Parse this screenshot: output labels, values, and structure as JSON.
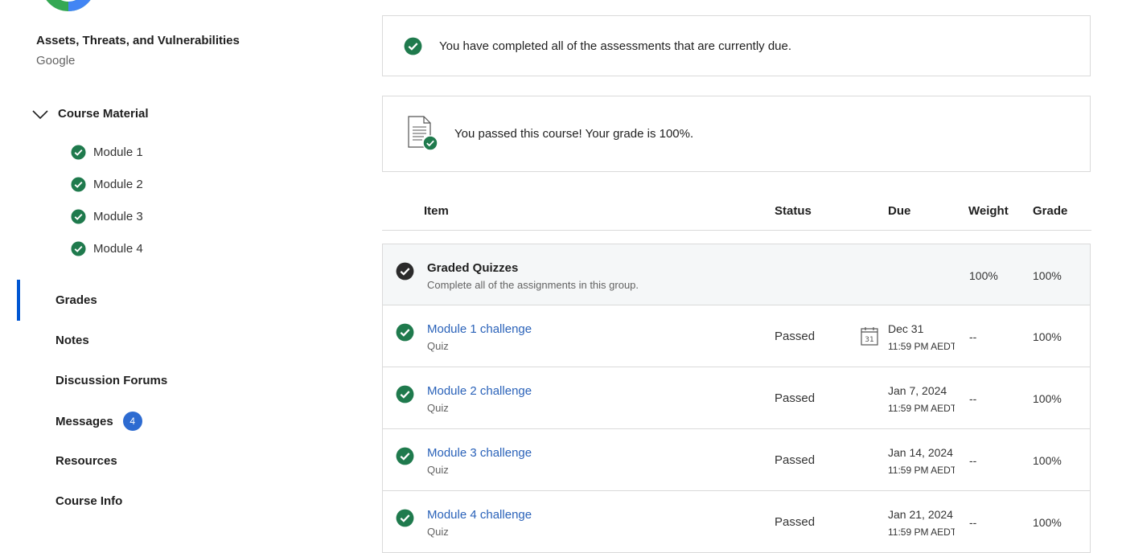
{
  "sidebar": {
    "course_title": "Assets, Threats, and Vulnerabilities",
    "course_org": "Google",
    "course_material_label": "Course Material",
    "modules": [
      {
        "label": "Module 1"
      },
      {
        "label": "Module 2"
      },
      {
        "label": "Module 3"
      },
      {
        "label": "Module 4"
      }
    ],
    "nav": {
      "grades": "Grades",
      "notes": "Notes",
      "discussion_forums": "Discussion Forums",
      "messages": "Messages",
      "messages_badge": "4",
      "resources": "Resources",
      "course_info": "Course Info"
    }
  },
  "main": {
    "assessments_notice": "You have completed all of the assessments that are currently due.",
    "passed_notice": "You passed this course! Your grade is 100%.",
    "table": {
      "headers": {
        "item": "Item",
        "status": "Status",
        "due": "Due",
        "weight": "Weight",
        "grade": "Grade"
      },
      "group": {
        "name": "Graded Quizzes",
        "description": "Complete all of the assignments in this group.",
        "weight": "100%",
        "grade": "100%"
      },
      "rows": [
        {
          "name": "Module 1 challenge",
          "type": "Quiz",
          "status": "Passed",
          "due_date": "Dec 31",
          "due_time": "11:59 PM AEDT",
          "weight": "--",
          "grade": "100%"
        },
        {
          "name": "Module 2 challenge",
          "type": "Quiz",
          "status": "Passed",
          "due_date": "Jan 7, 2024",
          "due_time": "11:59 PM AEDT",
          "weight": "--",
          "grade": "100%"
        },
        {
          "name": "Module 3 challenge",
          "type": "Quiz",
          "status": "Passed",
          "due_date": "Jan 14, 2024",
          "due_time": "11:59 PM AEDT",
          "weight": "--",
          "grade": "100%"
        },
        {
          "name": "Module 4 challenge",
          "type": "Quiz",
          "status": "Passed",
          "due_date": "Jan 21, 2024",
          "due_time": "11:59 PM AEDT",
          "weight": "--",
          "grade": "100%"
        }
      ]
    }
  },
  "colors": {
    "accent": "#0056d2",
    "success": "#1f7a4d",
    "link": "#2a62b9",
    "badge": "#2d6bd1"
  }
}
